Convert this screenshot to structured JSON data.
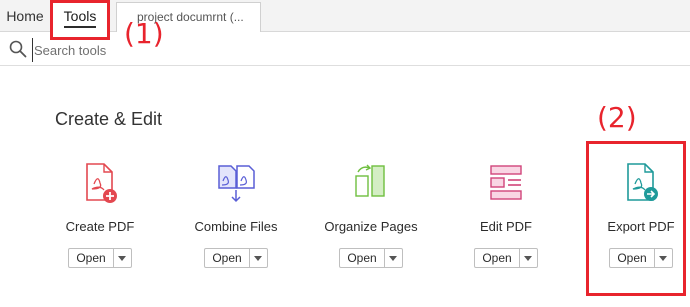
{
  "tabs": {
    "home": "Home",
    "tools": "Tools",
    "document": "project documrnt (..."
  },
  "search": {
    "placeholder": "Search tools"
  },
  "section": {
    "title": "Create & Edit"
  },
  "tools": [
    {
      "label": "Create PDF",
      "icon": "create-pdf-icon",
      "color": "#e34850",
      "open": "Open"
    },
    {
      "label": "Combine Files",
      "icon": "combine-files-icon",
      "color": "#5a5fd6",
      "open": "Open"
    },
    {
      "label": "Organize Pages",
      "icon": "organize-pages-icon",
      "color": "#6fbf3f",
      "open": "Open"
    },
    {
      "label": "Edit PDF",
      "icon": "edit-pdf-icon",
      "color": "#d1447a",
      "open": "Open"
    },
    {
      "label": "Export PDF",
      "icon": "export-pdf-icon",
      "color": "#1f9a9a",
      "open": "Open"
    }
  ],
  "annotations": {
    "one": "(1)",
    "two": "(2)",
    "color": "#e8242d"
  }
}
